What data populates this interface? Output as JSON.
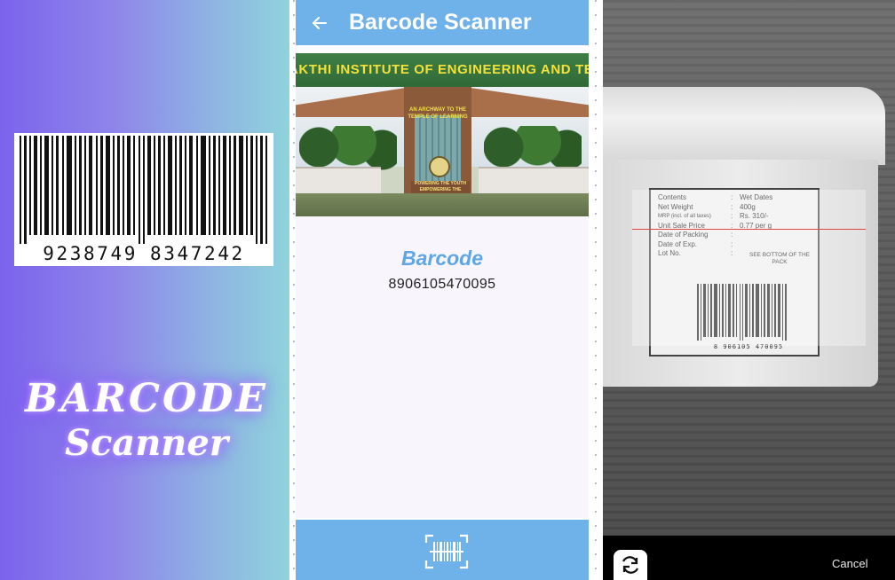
{
  "promo": {
    "barcode_left_digits": "9238749",
    "barcode_right_digits": "8347242",
    "title_line1": "BARCODE",
    "title_line2": "Scanner"
  },
  "app": {
    "appbar": {
      "back_icon": "arrow-left-icon",
      "title": "Barcode Scanner"
    },
    "banner": {
      "institution_name": "AKTHI INSTITUTE OF ENGINEERING AND TECH",
      "arch_text": "AN ARCHWAY TO THE TEMPLE OF LEARNING",
      "sign_text": "POWERING THE YOUTH EMPOWERING THE NATION"
    },
    "result": {
      "label": "Barcode",
      "value": "8906105470095"
    },
    "bottombar": {
      "scan_icon": "barcode-scan-icon"
    },
    "colors": {
      "primary": "#6fb2ea",
      "result_label": "#5fa6e6",
      "result_background": "#f8f6fc"
    }
  },
  "camera": {
    "label": {
      "rows": [
        {
          "key": "Contents",
          "value": "Wet Dates"
        },
        {
          "key": "Net Weight",
          "value": "400g"
        },
        {
          "key": "MRP (incl. of all taxes)",
          "value": "Rs. 310/-"
        },
        {
          "key": "Unit Sale Price",
          "value": "0.77 per g"
        },
        {
          "key": "Date of Packing",
          "value": ""
        },
        {
          "key": "Date of Exp.",
          "value": ""
        },
        {
          "key": "Lot No.",
          "value": ""
        }
      ],
      "see_bottom": "SEE BOTTOM OF THE PACK",
      "digits": "8 906105 470095"
    },
    "controls": {
      "flip_icon": "camera-flip-icon",
      "cancel_label": "Cancel"
    },
    "colors": {
      "scan_line": "#e0463c",
      "bottom_bar": "#000000"
    }
  }
}
